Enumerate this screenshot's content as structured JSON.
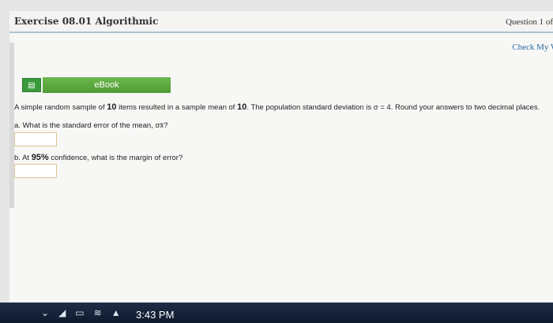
{
  "header": {
    "exercise_title": "Exercise 08.01 Algorithmic",
    "question_label": "Question 1 of"
  },
  "check_work": "Check My Wo",
  "ebook": {
    "icon": "book-icon",
    "label": "eBook"
  },
  "problem": {
    "part1": "A simple random sample of",
    "n": "10",
    "part2": "items resulted in a sample mean of",
    "mean": "10",
    "part3": ". The population standard deviation is",
    "sigma_expr": "σ = 4",
    "part4": ". Round your answers to two decimal places."
  },
  "parts": [
    {
      "prefix": "a.",
      "text": "What is the standard error of the mean,",
      "symbol": "σx̄",
      "suffix": "?"
    },
    {
      "prefix": "b.",
      "text1": "At",
      "confidence": "95%",
      "text2": "confidence, what is the margin of error?"
    }
  ],
  "taskbar": {
    "icons": [
      "chevron-icon",
      "volume-icon",
      "battery-icon",
      "wifi-icon",
      "caret-up-icon"
    ],
    "time": "3:43 PM"
  }
}
